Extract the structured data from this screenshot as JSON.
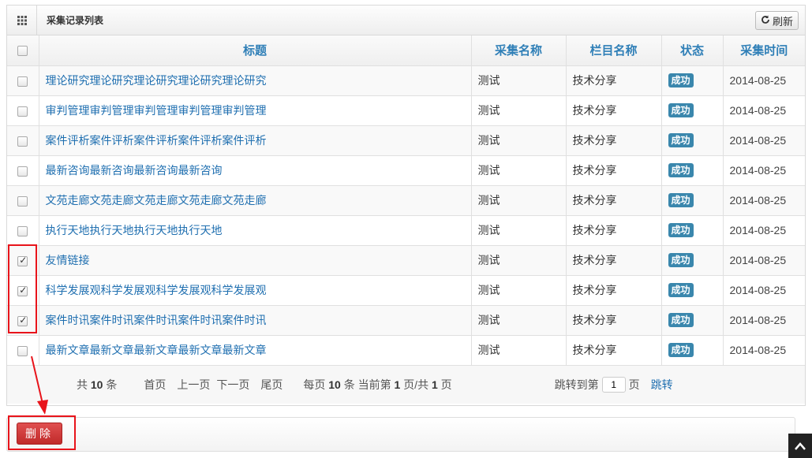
{
  "panel": {
    "title": "采集记录列表",
    "refresh_label": "刷新"
  },
  "table": {
    "columns": [
      "标题",
      "采集名称",
      "栏目名称",
      "状态",
      "采集时间"
    ],
    "rows": [
      {
        "title": "理论研究理论研究理论研究理论研究理论研究",
        "collect_name": "测试",
        "column_name": "技术分享",
        "status": "成功",
        "time": "2014-08-25",
        "checked": false
      },
      {
        "title": "审判管理审判管理审判管理审判管理审判管理",
        "collect_name": "测试",
        "column_name": "技术分享",
        "status": "成功",
        "time": "2014-08-25",
        "checked": false
      },
      {
        "title": "案件评析案件评析案件评析案件评析案件评析",
        "collect_name": "测试",
        "column_name": "技术分享",
        "status": "成功",
        "time": "2014-08-25",
        "checked": false
      },
      {
        "title": "最新咨询最新咨询最新咨询最新咨询",
        "collect_name": "测试",
        "column_name": "技术分享",
        "status": "成功",
        "time": "2014-08-25",
        "checked": false
      },
      {
        "title": "文苑走廊文苑走廊文苑走廊文苑走廊文苑走廊",
        "collect_name": "测试",
        "column_name": "技术分享",
        "status": "成功",
        "time": "2014-08-25",
        "checked": false
      },
      {
        "title": "执行天地执行天地执行天地执行天地",
        "collect_name": "测试",
        "column_name": "技术分享",
        "status": "成功",
        "time": "2014-08-25",
        "checked": false
      },
      {
        "title": "友情链接",
        "collect_name": "测试",
        "column_name": "技术分享",
        "status": "成功",
        "time": "2014-08-25",
        "checked": true
      },
      {
        "title": "科学发展观科学发展观科学发展观科学发展观",
        "collect_name": "测试",
        "column_name": "技术分享",
        "status": "成功",
        "time": "2014-08-25",
        "checked": true
      },
      {
        "title": "案件时讯案件时讯案件时讯案件时讯案件时讯",
        "collect_name": "测试",
        "column_name": "技术分享",
        "status": "成功",
        "time": "2014-08-25",
        "checked": true
      },
      {
        "title": "最新文章最新文章最新文章最新文章最新文章",
        "collect_name": "测试",
        "column_name": "技术分享",
        "status": "成功",
        "time": "2014-08-25",
        "checked": false
      }
    ]
  },
  "pager": {
    "total_prefix": "共",
    "total_count": "10",
    "total_suffix": "条",
    "first": "首页",
    "prev": "上一页",
    "next": "下一页",
    "last": "尾页",
    "per_page_prefix": "每页",
    "per_page": "10",
    "per_page_mid": "条 当前第",
    "current_page": "1",
    "page_mid": "页/共",
    "total_pages": "1",
    "page_suffix": "页",
    "jump_prefix": "跳转到第",
    "jump_value": "1",
    "jump_suffix": "页",
    "jump_button": "跳转"
  },
  "actions": {
    "delete_label": "删除"
  },
  "colors": {
    "accent": "#2f7fb7",
    "badge": "#3a87ad",
    "danger": "#d03838",
    "highlight": "#e8141b"
  }
}
